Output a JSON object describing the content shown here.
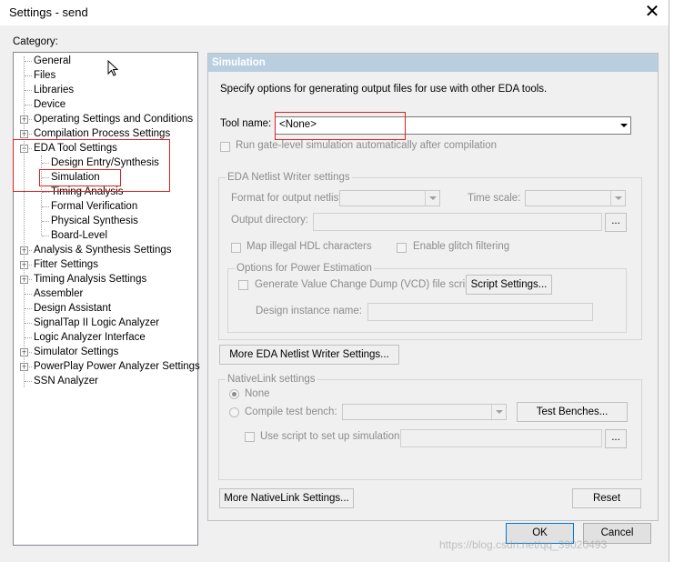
{
  "window": {
    "title": "Settings - send",
    "close_glyph": "✕"
  },
  "category_label": "Category:",
  "tree": [
    {
      "label": "General",
      "level": 1,
      "expander": ""
    },
    {
      "label": "Files",
      "level": 1,
      "expander": ""
    },
    {
      "label": "Libraries",
      "level": 1,
      "expander": ""
    },
    {
      "label": "Device",
      "level": 1,
      "expander": ""
    },
    {
      "label": "Operating Settings and Conditions",
      "level": 1,
      "expander": "+"
    },
    {
      "label": "Compilation Process Settings",
      "level": 1,
      "expander": "+"
    },
    {
      "label": "EDA Tool Settings",
      "level": 1,
      "expander": "−"
    },
    {
      "label": "Design Entry/Synthesis",
      "level": 2,
      "expander": ""
    },
    {
      "label": "Simulation",
      "level": 2,
      "expander": ""
    },
    {
      "label": "Timing Analysis",
      "level": 2,
      "expander": ""
    },
    {
      "label": "Formal Verification",
      "level": 2,
      "expander": ""
    },
    {
      "label": "Physical Synthesis",
      "level": 2,
      "expander": ""
    },
    {
      "label": "Board-Level",
      "level": 2,
      "expander": ""
    },
    {
      "label": "Analysis & Synthesis Settings",
      "level": 1,
      "expander": "+"
    },
    {
      "label": "Fitter Settings",
      "level": 1,
      "expander": "+"
    },
    {
      "label": "Timing Analysis Settings",
      "level": 1,
      "expander": "+"
    },
    {
      "label": "Assembler",
      "level": 1,
      "expander": ""
    },
    {
      "label": "Design Assistant",
      "level": 1,
      "expander": ""
    },
    {
      "label": "SignalTap II Logic Analyzer",
      "level": 1,
      "expander": ""
    },
    {
      "label": "Logic Analyzer Interface",
      "level": 1,
      "expander": ""
    },
    {
      "label": "Simulator Settings",
      "level": 1,
      "expander": "+"
    },
    {
      "label": "PowerPlay Power Analyzer Settings",
      "level": 1,
      "expander": "+"
    },
    {
      "label": "SSN Analyzer",
      "level": 1,
      "expander": ""
    }
  ],
  "panel": {
    "header": "Simulation",
    "description": "Specify options for generating output files for use with other EDA tools.",
    "tool_name_label": "Tool name:",
    "tool_name_value": "<None>",
    "run_gate_level": "Run gate-level simulation automatically after compilation",
    "netlist_group": {
      "title": "EDA Netlist Writer settings",
      "format_label": "Format for output netlist:",
      "time_scale_label": "Time scale:",
      "output_dir_label": "Output directory:",
      "browse": "...",
      "map_illegal": "Map illegal HDL characters",
      "glitch": "Enable glitch filtering",
      "power_group": {
        "title": "Options for Power Estimation",
        "vcd": "Generate Value Change Dump (VCD) file script",
        "script_settings": "Script Settings...",
        "instance_label": "Design instance name:"
      }
    },
    "more_netlist_button": "More EDA Netlist Writer Settings...",
    "nativelink_group": {
      "title": "NativeLink settings",
      "none": "None",
      "compile_tb": "Compile test bench:",
      "test_benches": "Test Benches...",
      "use_script": "Use script to set up simulation:",
      "browse": "..."
    },
    "more_nativelink_button": "More NativeLink Settings...",
    "reset_button": "Reset"
  },
  "buttons": {
    "ok": "OK",
    "cancel": "Cancel"
  },
  "watermark": "https://blog.csdn.net/qq_39020493",
  "colors": {
    "header_bg": "#b9cfe0",
    "highlight": "#e02020",
    "default_border": "#0078d7"
  }
}
